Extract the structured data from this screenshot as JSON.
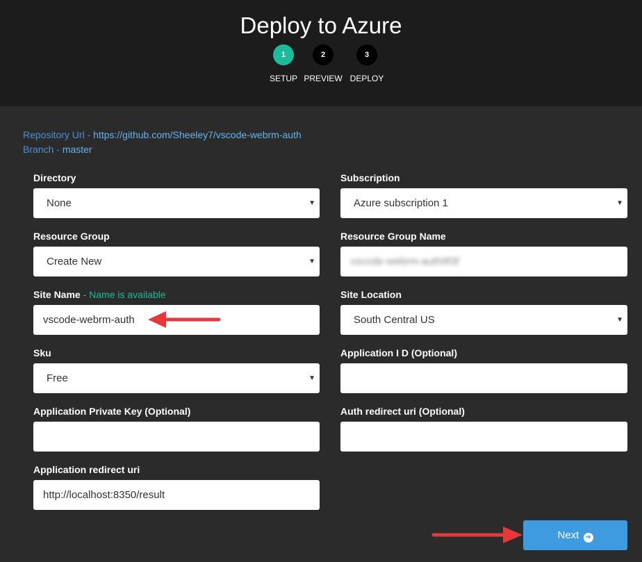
{
  "header": {
    "title": "Deploy to Azure",
    "steps": [
      {
        "number": "1",
        "label": "SETUP",
        "active": true
      },
      {
        "number": "2",
        "label": "PREVIEW",
        "active": false
      },
      {
        "number": "3",
        "label": "DEPLOY",
        "active": false
      }
    ]
  },
  "repo": {
    "url_label": "Repository Url - ",
    "url_value": "https://github.com/Sheeley7/vscode-webrm-auth",
    "branch_label": "Branch - ",
    "branch_value": "master"
  },
  "form": {
    "directory": {
      "label": "Directory",
      "value": "None"
    },
    "subscription": {
      "label": "Subscription",
      "value": "Azure subscription 1"
    },
    "resource_group": {
      "label": "Resource Group",
      "value": "Create New"
    },
    "resource_group_name": {
      "label": "Resource Group Name",
      "value": "vscode-webrm-auth9f3f"
    },
    "site_name": {
      "label": "Site Name",
      "status": " - Name is available",
      "value": "vscode-webrm-auth"
    },
    "site_location": {
      "label": "Site Location",
      "value": "South Central US"
    },
    "sku": {
      "label": "Sku",
      "value": "Free"
    },
    "application_id": {
      "label": "Application I D (Optional)",
      "value": ""
    },
    "application_private_key": {
      "label": "Application Private Key (Optional)",
      "value": ""
    },
    "auth_redirect_uri": {
      "label": "Auth redirect uri (Optional)",
      "value": ""
    },
    "application_redirect_uri": {
      "label": "Application redirect uri",
      "value": "http://localhost:8350/result"
    }
  },
  "actions": {
    "next_label": "Next"
  },
  "icons": {
    "select_caret": "caret-down-icon",
    "next": "arrow-circle-right-icon",
    "annotation": "red-arrow-annotation"
  },
  "colors": {
    "accent": "#1abc9c",
    "button": "#3e9bdf",
    "link": "#62b5f2",
    "annotation": "#e8373a"
  }
}
